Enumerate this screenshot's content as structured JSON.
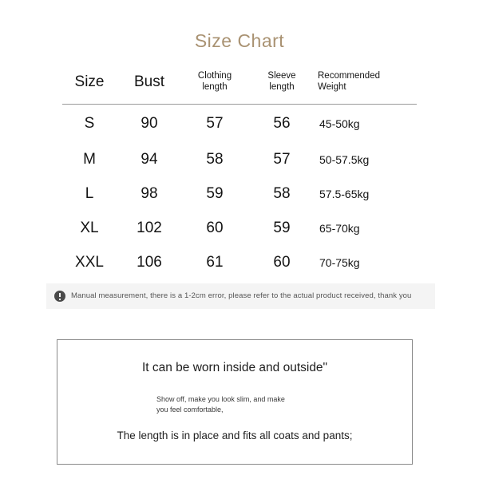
{
  "title": "Size Chart",
  "accent_color": "#a99272",
  "table": {
    "columns": [
      {
        "key": "size",
        "label": "Size",
        "style": "big"
      },
      {
        "key": "bust",
        "label": "Bust",
        "style": "big"
      },
      {
        "key": "cloth",
        "label": "Clothing\nlength",
        "style": "small"
      },
      {
        "key": "sleeve",
        "label": "Sleeve\nlength",
        "style": "small"
      },
      {
        "key": "weight",
        "label": "Recommended\nWeight",
        "style": "small-left"
      }
    ],
    "headers": {
      "size": "Size",
      "bust": "Bust",
      "clothing_length_line1": "Clothing",
      "clothing_length_line2": "length",
      "sleeve_length_line1": "Sleeve",
      "sleeve_length_line2": "length",
      "recommended_weight_line1": "Recommended",
      "recommended_weight_line2": "Weight"
    },
    "rows": [
      {
        "size": "S",
        "bust": "90",
        "clothing_length": "57",
        "sleeve_length": "56",
        "weight": "45-50kg"
      },
      {
        "size": "M",
        "bust": "94",
        "clothing_length": "58",
        "sleeve_length": "57",
        "weight": "50-57.5kg"
      },
      {
        "size": "L",
        "bust": "98",
        "clothing_length": "59",
        "sleeve_length": "58",
        "weight": "57.5-65kg"
      },
      {
        "size": "XL",
        "bust": "102",
        "clothing_length": "60",
        "sleeve_length": "59",
        "weight": "65-70kg"
      },
      {
        "size": "XXL",
        "bust": "106",
        "clothing_length": "61",
        "sleeve_length": "60",
        "weight": "70-75kg"
      }
    ]
  },
  "notice": {
    "icon": "info-exclamation-icon",
    "text": "Manual measurement, there is a 1-2cm error, please refer to the actual product received, thank you",
    "background_color": "#f4f4f4",
    "icon_color": "#4a4a4a"
  },
  "description": {
    "headline": "It can be worn inside and outside\"",
    "sub_line1": "Show off, make you look slim, and make",
    "sub_line2": "you feel comfortable,",
    "footline": "The length is in place and fits all coats and pants;"
  }
}
